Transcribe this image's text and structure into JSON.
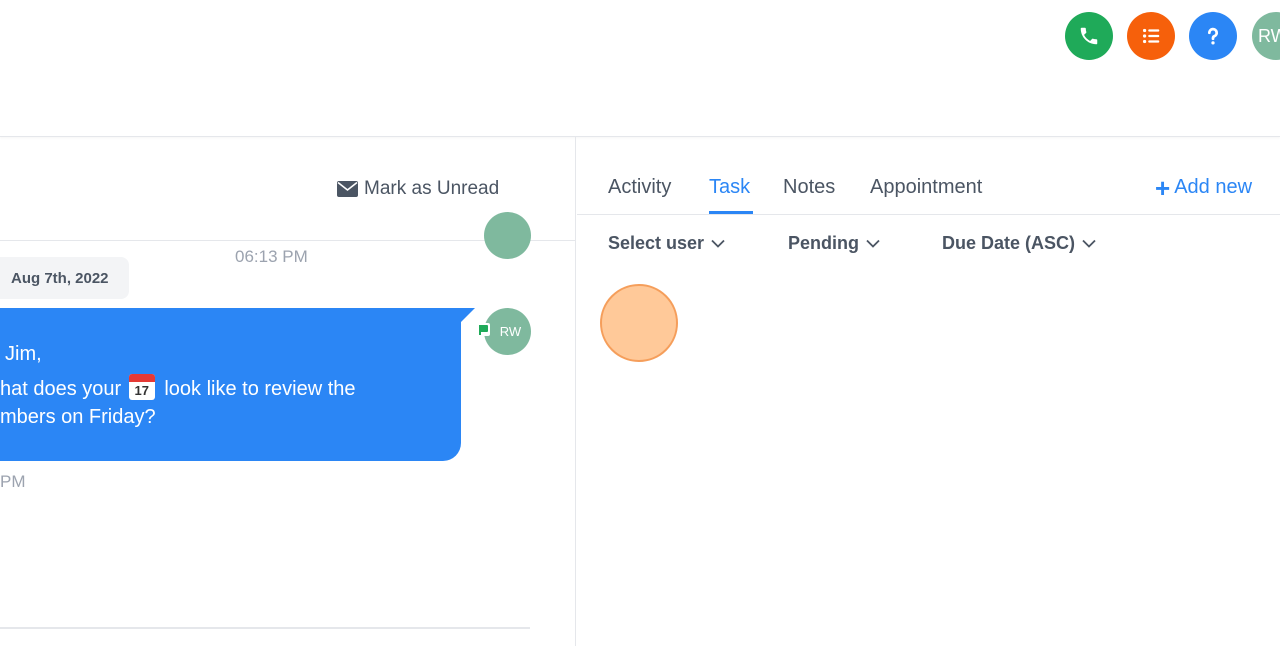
{
  "header": {
    "buttons": [
      {
        "name": "phone",
        "icon": "phone-icon",
        "color": "#1faa59"
      },
      {
        "name": "tasks",
        "icon": "list-icon",
        "color": "#f6600b"
      },
      {
        "name": "help",
        "icon": "question-icon",
        "color": "#2b86f5"
      }
    ],
    "user_avatar_initials": "RW",
    "avatar_color": "#7fb99e"
  },
  "conversation": {
    "mark_unread_label": "Mark as Unread",
    "earlier_time": "06:13 PM",
    "date_divider": "Aug 7th, 2022",
    "message": {
      "line1": "Jim,",
      "line2_before": "hat does your",
      "emoji_day": "17",
      "line2_after": "look like to review the",
      "line3": "mbers on Friday?",
      "sender_initials": "RW",
      "time": "PM",
      "bubble_color": "#2b86f5"
    }
  },
  "panel": {
    "tabs": [
      {
        "label": "Activity",
        "active": false
      },
      {
        "label": "Task",
        "active": true
      },
      {
        "label": "Notes",
        "active": false
      },
      {
        "label": "Appointment",
        "active": false
      }
    ],
    "add_new_label": "Add new",
    "filters": {
      "user": "Select user",
      "status": "Pending",
      "sort": "Due Date (ASC)"
    },
    "accent_color": "#2b86f5"
  }
}
